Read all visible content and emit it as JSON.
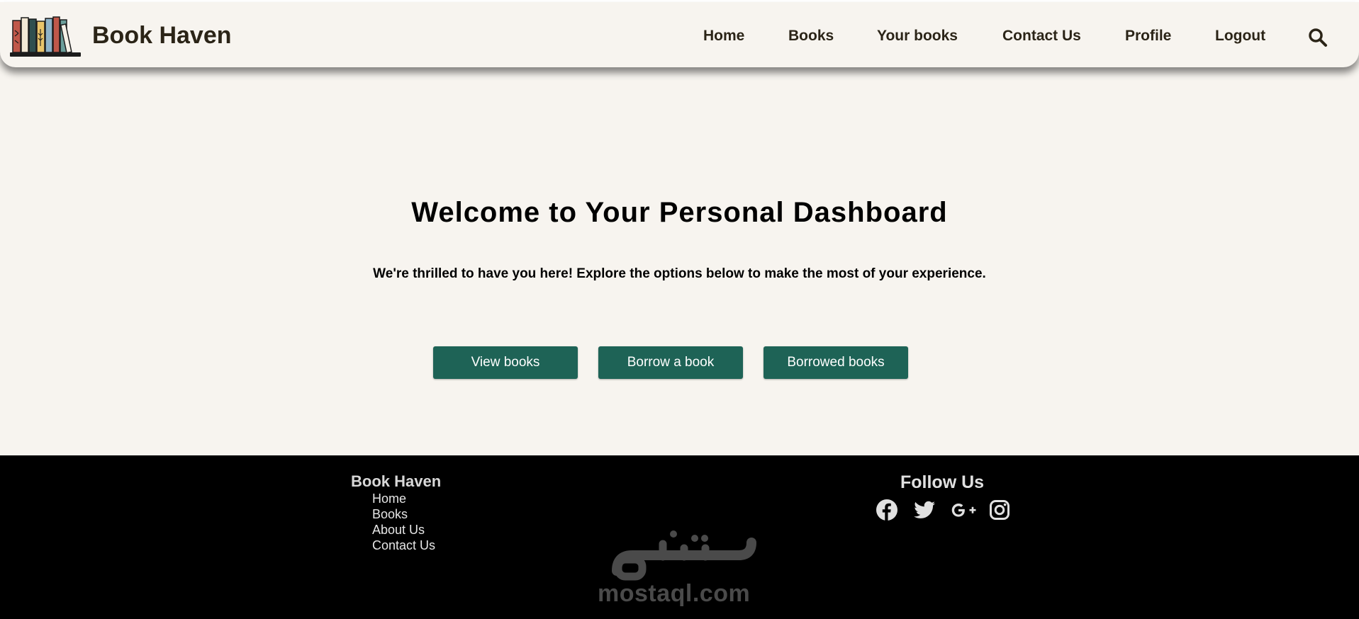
{
  "header": {
    "brand": "Book Haven",
    "nav": [
      {
        "label": "Home"
      },
      {
        "label": "Books"
      },
      {
        "label": "Your books"
      },
      {
        "label": "Contact Us"
      },
      {
        "label": "Profile"
      },
      {
        "label": "Logout"
      }
    ],
    "search_icon": "search-icon"
  },
  "main": {
    "title": "Welcome to Your Personal Dashboard",
    "subtitle": "We're thrilled to have you here! Explore the options below to make the most of your experience.",
    "buttons": [
      {
        "label": "View books"
      },
      {
        "label": "Borrow a book"
      },
      {
        "label": "Borrowed books"
      }
    ]
  },
  "footer": {
    "brand": "Book Haven",
    "links": [
      {
        "label": "Home"
      },
      {
        "label": "Books"
      },
      {
        "label": "About Us"
      },
      {
        "label": "Contact Us"
      }
    ],
    "follow_title": "Follow Us",
    "social": [
      "facebook-icon",
      "twitter-icon",
      "google-plus-icon",
      "instagram-icon"
    ],
    "watermark": "mostaql.com"
  },
  "colors": {
    "background": "#f7f4ef",
    "accent_button": "#1e6356",
    "text_dark": "#2b2417",
    "footer_bg": "#000000"
  }
}
